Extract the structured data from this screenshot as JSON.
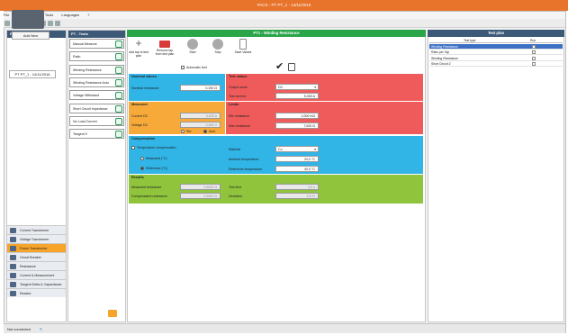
{
  "app": {
    "title": "PACS - PT PT_1 - 14/11/2016"
  },
  "menu": [
    "File",
    "Test Control",
    "Tools",
    "Languages",
    "?"
  ],
  "left_panel": {
    "header": "Power Transformer",
    "add_new": "Add New",
    "device_item": "PT PT_1 - 14/11/2016",
    "nav": [
      {
        "label": "Current Transformer",
        "active": false
      },
      {
        "label": "Voltage Transformer",
        "active": false
      },
      {
        "label": "Power Transformer",
        "active": true
      },
      {
        "label": "Circuit Breaker",
        "active": false
      },
      {
        "label": "Resistance",
        "active": false
      },
      {
        "label": "Current & Measurement",
        "active": false
      },
      {
        "label": "Tangent Delta & Capacitance",
        "active": false
      },
      {
        "label": "Reactor",
        "active": false
      }
    ]
  },
  "tests_panel": {
    "header": "PT - Tests",
    "items": [
      "Manual Measure",
      "Ratio",
      "Winding Resistance",
      "Winding Resistance Auto",
      "Voltage Withstand",
      "Short Circuit Impedance",
      "No Load Current",
      "Tangent δ"
    ]
  },
  "center": {
    "title": "PT1 - Winding Resistance",
    "tools": [
      "Add tap to test plan",
      "Remove tap from test plan",
      "Start",
      "Stop",
      "Save Values"
    ],
    "automatic_test_label": "Automatic test",
    "nominal": {
      "header": "Nominal values",
      "resistance_label": "Nominal resistance",
      "resistance_value": "0.100 Ω"
    },
    "test_values": {
      "header": "Test values",
      "output_label": "Output mode",
      "output_value": "DC",
      "test_current_label": "Test current",
      "test_current_value": "5,000 A"
    },
    "measured": {
      "header": "Measured",
      "current_label": "Current DC",
      "current_value": "0,000 A",
      "voltage_label": "Voltage DC",
      "voltage_value": "0,000 V",
      "radio_a": "Std",
      "radio_b": "Auto"
    },
    "limits": {
      "header": "Limits",
      "min_label": "Min resistance",
      "min_value": "1,000 mΩ",
      "max_label": "Max resistance",
      "max_value": "7,000 Ω"
    },
    "compensation": {
      "header": "Compensation",
      "temp_label": "Temperature compensation",
      "measured_label": "Measured (°C)",
      "reference_label": "Reference (°C)",
      "material_label": "Material",
      "material_value": "Cu",
      "ambient_label": "Ambient temperature",
      "ambient_value": "20,0 °C",
      "refwind_label": "Reference temperature",
      "refwind_value": "40,0 °C"
    },
    "results": {
      "header": "Results",
      "measured_label": "Measured resistance",
      "measured_value": "0,0000 Ω",
      "comp_label": "Compensated resistance",
      "comp_value": "0,0000 Ω",
      "time_label": "Test time",
      "time_value": "0,0 s",
      "dev_label": "Deviation",
      "dev_value": "0,0 %"
    }
  },
  "test_plan": {
    "title": "Test plan",
    "col_type": "Test type",
    "col_run": "Run",
    "rows": [
      "Winding Resistance",
      "Ratio per Tap",
      "Winding Resistance",
      "Short Circuit Z"
    ]
  },
  "status": {
    "text": "Not connected"
  },
  "colors": {
    "blue": "#31b4e6",
    "red": "#ef5b5b",
    "orange": "#f7aa3a",
    "green": "#8fc43c",
    "title_green": "#2aa54a",
    "navy": "#3d5978"
  }
}
